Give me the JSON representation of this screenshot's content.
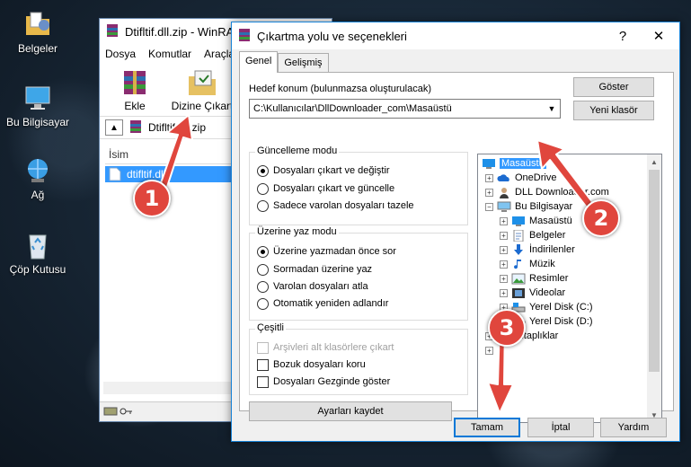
{
  "desktop": {
    "icons": [
      {
        "label": "Belgeler",
        "icon": "documents-folder-icon"
      },
      {
        "label": "Bu Bilgisayar",
        "icon": "computer-icon"
      },
      {
        "label": "Ağ",
        "icon": "network-icon"
      },
      {
        "label": "Çöp Kutusu",
        "icon": "recycle-bin-icon"
      }
    ]
  },
  "winrar": {
    "title": "Dtifltif.dll.zip - WinRA",
    "menu": [
      "Dosya",
      "Komutlar",
      "Araçla"
    ],
    "toolbar": {
      "add_label": "Ekle",
      "extract_label": "Dizine Çıkart"
    },
    "path": "Dtifltif.dll.zip",
    "list_header": "İsim",
    "selected_file": "dtifltif.dll"
  },
  "dialog": {
    "title": "Çıkartma yolu ve seçenekleri",
    "help_glyph": "?",
    "close_glyph": "✕",
    "tabs": [
      "Genel",
      "Gelişmiş"
    ],
    "dest_label": "Hedef konum (bulunmazsa oluşturulacak)",
    "dest_value": "C:\\Kullanıcılar\\DllDownloader_com\\Masaüstü",
    "show_button": "Göster",
    "new_folder_button": "Yeni klasör",
    "update_mode": {
      "title": "Güncelleme modu",
      "options": [
        "Dosyaları çıkart ve değiştir",
        "Dosyaları çıkart ve güncelle",
        "Sadece varolan dosyaları tazele"
      ],
      "selected": 0
    },
    "overwrite_mode": {
      "title": "Üzerine yaz modu",
      "options": [
        "Üzerine yazmadan önce sor",
        "Sormadan üzerine yaz",
        "Varolan dosyaları atla",
        "Otomatik yeniden adlandır"
      ],
      "selected": 0
    },
    "misc": {
      "title": "Çeşitli",
      "options": [
        "Arşivleri alt klasörlere çıkart",
        "Bozuk dosyaları koru",
        "Dosyaları Gezginde göster"
      ],
      "disabled_index": 0
    },
    "save_settings_button": "Ayarları kaydet",
    "tree": [
      {
        "label": "Masaüstü",
        "selected": true,
        "icon": "desktop-icon"
      },
      {
        "label": "OneDrive",
        "icon": "onedrive-icon"
      },
      {
        "label": "DLL Downloader.com",
        "icon": "user-icon"
      },
      {
        "label": "Bu Bilgisayar",
        "icon": "computer-icon"
      },
      {
        "label": "Masaüstü",
        "icon": "desktop-icon"
      },
      {
        "label": "Belgeler",
        "icon": "documents-icon"
      },
      {
        "label": "İndirilenler",
        "icon": "download-icon"
      },
      {
        "label": "Müzik",
        "icon": "music-icon"
      },
      {
        "label": "Resimler",
        "icon": "pictures-icon"
      },
      {
        "label": "Videolar",
        "icon": "videos-icon"
      },
      {
        "label": "Yerel Disk (C:)",
        "icon": "drive-icon"
      },
      {
        "label": "Yerel Disk (D:)",
        "icon": "drive-icon"
      },
      {
        "label": "Kitaplıklar",
        "icon": "libraries-icon"
      }
    ],
    "ok_button": "Tamam",
    "cancel_button": "İptal",
    "help_button": "Yardım"
  },
  "annotations": [
    "1",
    "2",
    "3"
  ],
  "colors": {
    "annotation": "#e0463d",
    "selection": "#3399ff",
    "accent": "#0078d7"
  }
}
